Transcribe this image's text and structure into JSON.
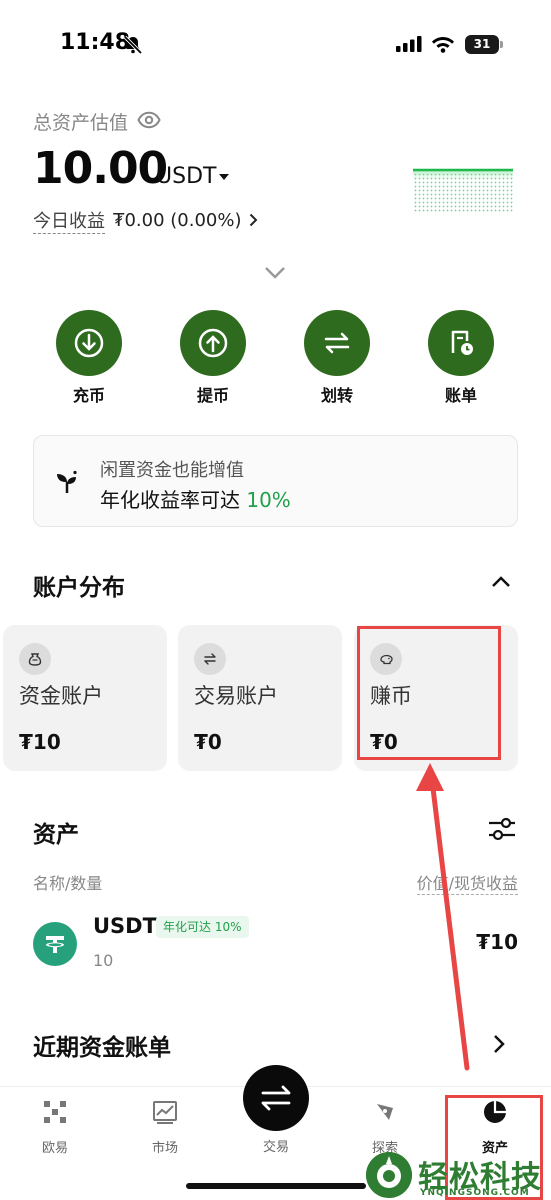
{
  "status_bar": {
    "time": "11:48",
    "battery": "31"
  },
  "total": {
    "label": "总资产估值",
    "value": "10.00",
    "unit": "USDT",
    "pnl_label": "今日收益",
    "pnl_value": "₮0.00 (0.00%)"
  },
  "actions": [
    {
      "label": "充币",
      "icon": "deposit-icon"
    },
    {
      "label": "提币",
      "icon": "withdraw-icon"
    },
    {
      "label": "划转",
      "icon": "transfer-icon"
    },
    {
      "label": "账单",
      "icon": "bill-icon"
    }
  ],
  "promo": {
    "line1": "闲置资金也能增值",
    "line2_prefix": "年化收益率可达 ",
    "line2_highlight": "10%"
  },
  "distribution": {
    "title": "账户分布",
    "accounts": [
      {
        "name": "资金账户",
        "value": "₮10"
      },
      {
        "name": "交易账户",
        "value": "₮0"
      },
      {
        "name": "赚币",
        "value": "₮0"
      }
    ]
  },
  "assets": {
    "title": "资产",
    "col_left": "名称/数量",
    "col_right": "价值/现货收益",
    "items": [
      {
        "name": "USDT",
        "badge": "年化可达 10%",
        "amount": "10",
        "value": "₮10"
      }
    ]
  },
  "recent": {
    "title": "近期资金账单"
  },
  "nav": {
    "items": [
      "欧易",
      "市场",
      "交易",
      "探索",
      "资产"
    ],
    "active": "资产"
  },
  "watermark": {
    "text": "轻松科技",
    "sub": "YNQINGSONG.COM"
  },
  "colors": {
    "accent_green": "#2e6b1f",
    "positive": "#22a04b",
    "annotation_red": "#e84545"
  }
}
